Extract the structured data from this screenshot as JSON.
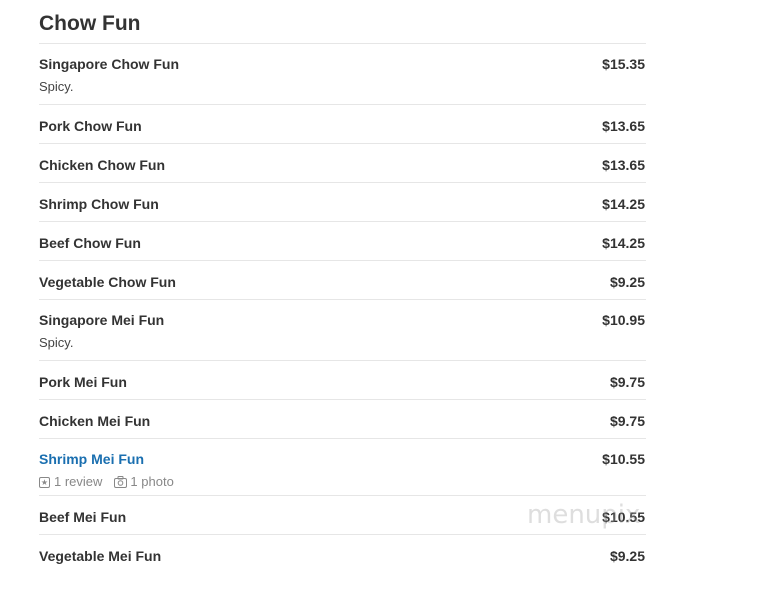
{
  "section": {
    "title": "Chow Fun"
  },
  "items": [
    {
      "name": "Singapore Chow Fun",
      "price": "$15.35",
      "desc": "Spicy."
    },
    {
      "name": "Pork Chow Fun",
      "price": "$13.65"
    },
    {
      "name": "Chicken Chow Fun",
      "price": "$13.65"
    },
    {
      "name": "Shrimp Chow Fun",
      "price": "$14.25"
    },
    {
      "name": "Beef Chow Fun",
      "price": "$14.25"
    },
    {
      "name": "Vegetable Chow Fun",
      "price": "$9.25"
    },
    {
      "name": "Singapore Mei Fun",
      "price": "$10.95",
      "desc": "Spicy."
    },
    {
      "name": "Pork Mei Fun",
      "price": "$9.75"
    },
    {
      "name": "Chicken Mei Fun",
      "price": "$9.75"
    },
    {
      "name": "Shrimp Mei Fun",
      "price": "$10.55",
      "reviews": "1 review",
      "photos": "1 photo"
    },
    {
      "name": "Beef Mei Fun",
      "price": "$10.55"
    },
    {
      "name": "Vegetable Mei Fun",
      "price": "$9.25"
    }
  ],
  "watermark": "menupix",
  "icons": {
    "review": "star-box-icon",
    "photo": "camera-icon"
  },
  "colors": {
    "link": "#1a6fb0",
    "divider": "#e6e6e6",
    "text": "#333333"
  }
}
